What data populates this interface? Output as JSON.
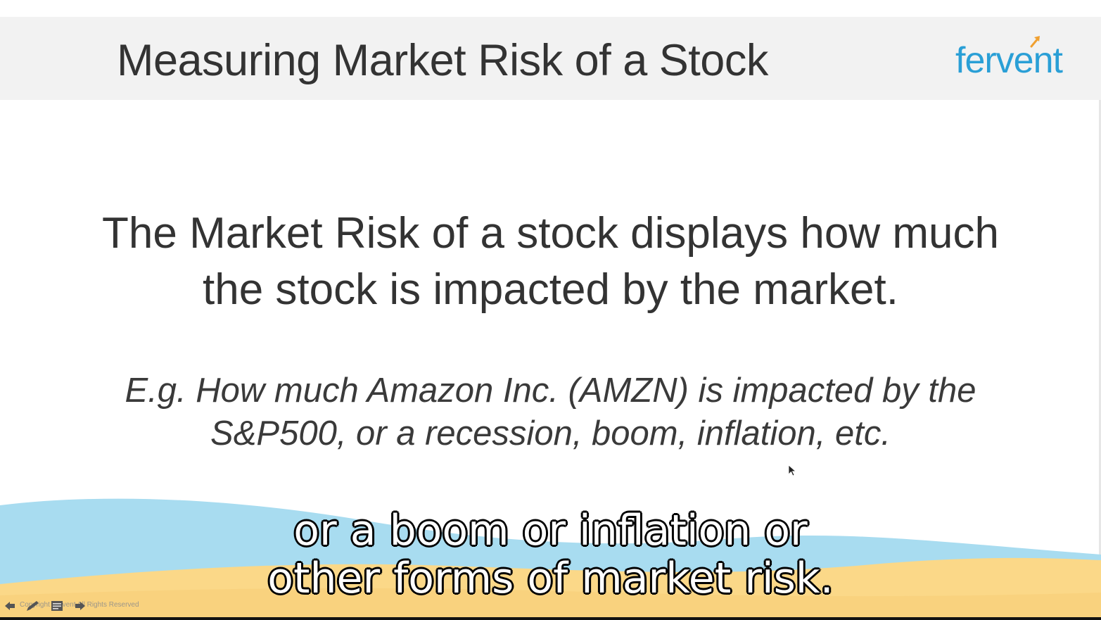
{
  "slide": {
    "title": "Measuring Market Risk of a Stock",
    "logo": "fervent",
    "main_text": "The Market Risk of a stock displays how much the stock is impacted by the market.",
    "example_text": "E.g. How much Amazon Inc. (AMZN) is impacted by the S&P500, or a recession, boom, inflation, etc."
  },
  "subtitle": {
    "line1": "or a boom or inflation or",
    "line2": "other forms of market risk."
  },
  "footer": {
    "copyright": "Copyright Fervent All Rights Reserved"
  },
  "colors": {
    "logo": "#2a9fd6",
    "wave_blue": "#a8dcf0",
    "wave_sand": "#fbd888",
    "header_bg": "#f2f2f2"
  },
  "icons": [
    "arrow-left-icon",
    "pen-icon",
    "notes-icon",
    "arrow-right-icon",
    "cursor-icon"
  ]
}
